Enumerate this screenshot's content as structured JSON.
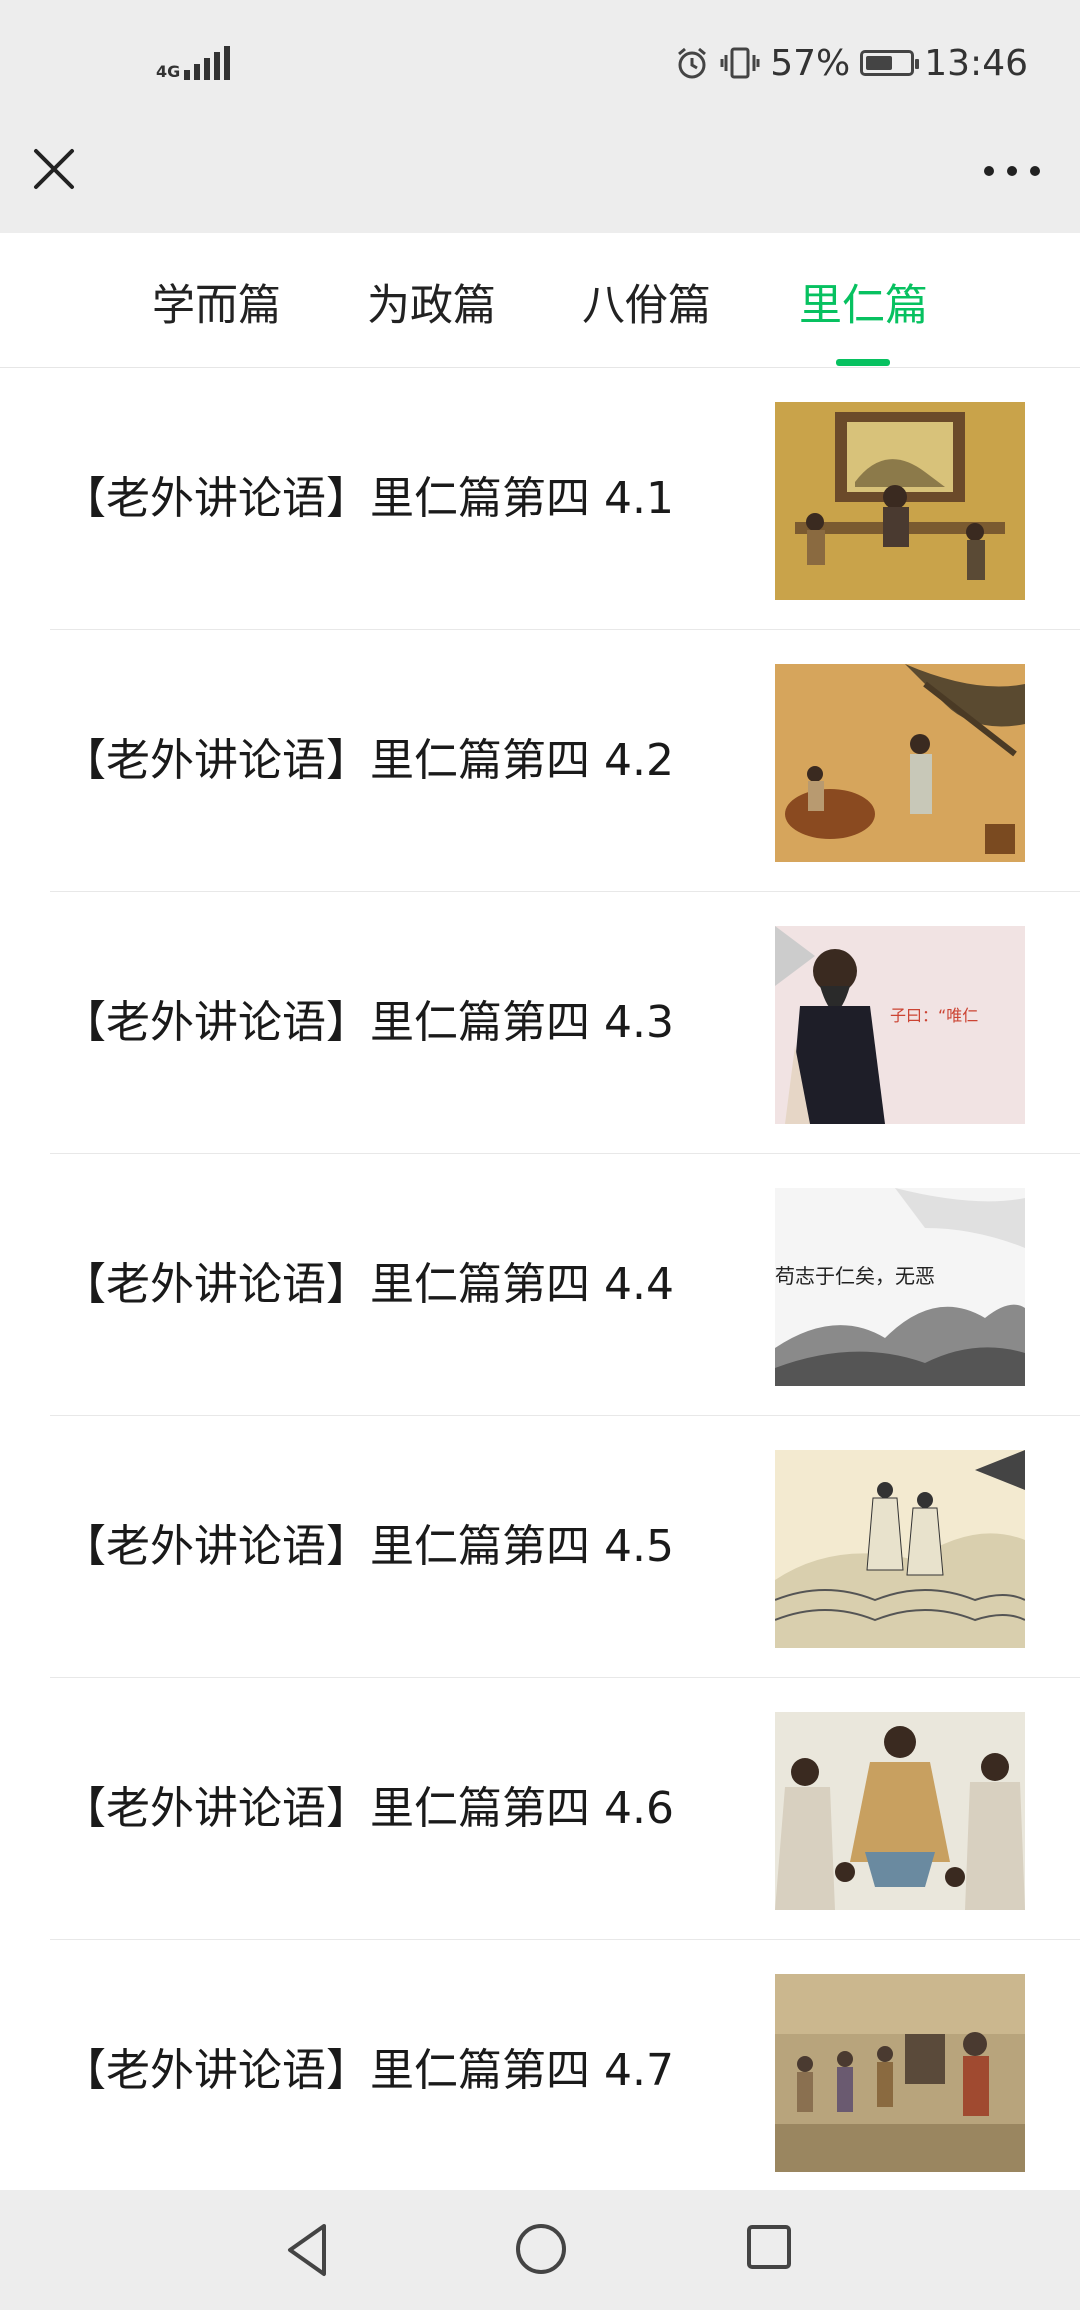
{
  "status_bar": {
    "network": "4G",
    "battery_percent": "57%",
    "time": "13:46",
    "icons": [
      "signal-icon",
      "alarm-icon",
      "vibrate-icon",
      "battery-icon"
    ]
  },
  "top_bar": {
    "close_icon": "close-icon",
    "more_icon": "more-icon"
  },
  "tabs": [
    {
      "label": "学而篇",
      "active": false
    },
    {
      "label": "为政篇",
      "active": false
    },
    {
      "label": "八佾篇",
      "active": false
    },
    {
      "label": "里仁篇",
      "active": true
    }
  ],
  "articles": [
    {
      "title": "【老外讲论语】里仁篇第四 4.1"
    },
    {
      "title": "【老外讲论语】里仁篇第四 4.2"
    },
    {
      "title": "【老外讲论语】里仁篇第四 4.3",
      "thumb_text": "子曰：“唯仁"
    },
    {
      "title": "【老外讲论语】里仁篇第四 4.4",
      "thumb_text": "苟志于仁矣，无恶"
    },
    {
      "title": "【老外讲论语】里仁篇第四 4.5"
    },
    {
      "title": "【老外讲论语】里仁篇第四 4.6"
    },
    {
      "title": "【老外讲论语】里仁篇第四 4.7"
    }
  ],
  "colors": {
    "accent": "#07c160",
    "header_bg": "#ededed",
    "text": "#1a1a1a"
  },
  "nav_bar": {
    "icons": [
      "back-icon",
      "home-icon",
      "recent-apps-icon"
    ]
  }
}
